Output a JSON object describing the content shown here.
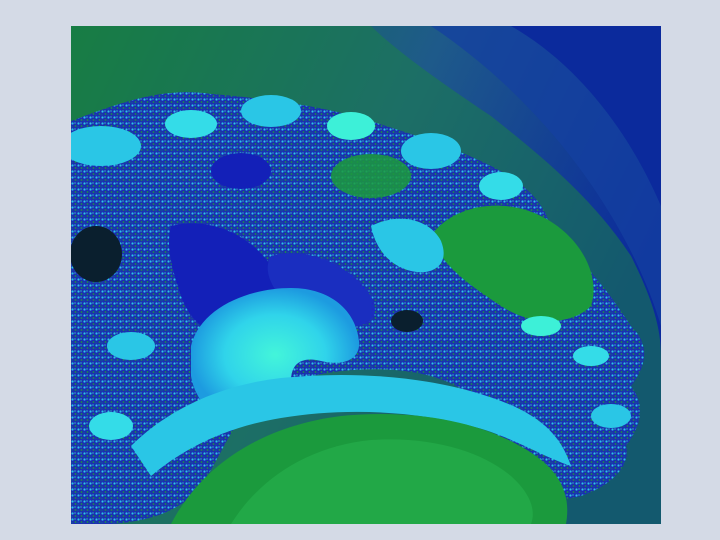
{
  "image": {
    "subject": "fractal-image",
    "palette": {
      "deep_blue": "#0b2a9c",
      "navy": "#1a3f8a",
      "teal_blue": "#1e5a8a",
      "dark_green": "#0f7a45",
      "green": "#1b9a3d",
      "bright_green": "#28b04a",
      "cyan": "#2ac6e6",
      "aqua": "#3df0d8",
      "royal_blue": "#1320b8",
      "dark_core": "#0a1f2e",
      "background": "#d4dae6"
    }
  }
}
